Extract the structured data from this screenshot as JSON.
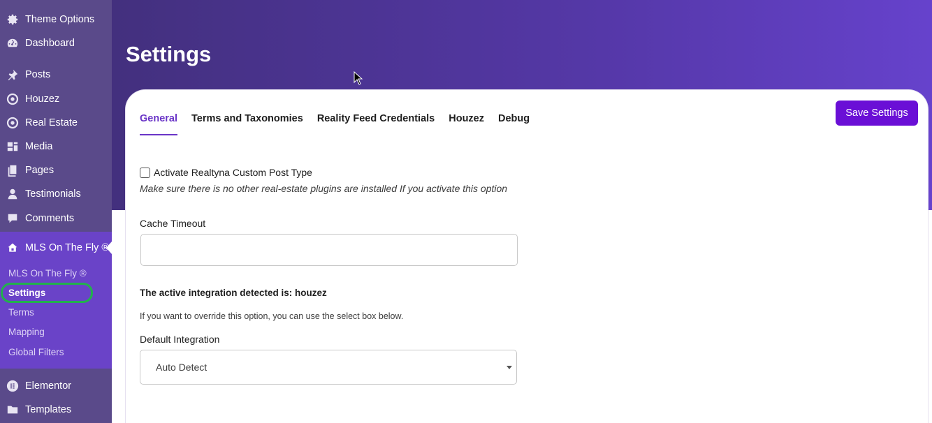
{
  "sidebar": {
    "items": [
      {
        "label": "Theme Options",
        "icon": "gear-icon"
      },
      {
        "label": "Dashboard",
        "icon": "dashboard-icon"
      },
      {
        "label": "Posts",
        "icon": "pin-icon"
      },
      {
        "label": "Houzez",
        "icon": "location-icon"
      },
      {
        "label": "Real Estate",
        "icon": "location-icon"
      },
      {
        "label": "Media",
        "icon": "media-icon"
      },
      {
        "label": "Pages",
        "icon": "pages-icon"
      },
      {
        "label": "Testimonials",
        "icon": "user-icon"
      },
      {
        "label": "Comments",
        "icon": "comment-icon"
      }
    ],
    "active_menu": {
      "label": "MLS On The Fly ®",
      "icon": "house-icon"
    },
    "submenu": [
      {
        "label": "MLS On The Fly ®"
      },
      {
        "label": "Settings",
        "current": true
      },
      {
        "label": "Terms"
      },
      {
        "label": "Mapping"
      },
      {
        "label": "Global Filters"
      }
    ],
    "bottom_items": [
      {
        "label": "Elementor",
        "icon": "elementor-icon"
      },
      {
        "label": "Templates",
        "icon": "folder-icon"
      }
    ]
  },
  "page": {
    "title": "Settings"
  },
  "tabs": [
    "General",
    "Terms and Taxonomies",
    "Reality Feed Credentials",
    "Houzez",
    "Debug"
  ],
  "active_tab": "General",
  "save_button": "Save Settings",
  "form": {
    "checkbox_label": "Activate Realtyna Custom Post Type",
    "checkbox_checked": false,
    "checkbox_hint": "Make sure there is no other real-estate plugins are installed If you activate this option",
    "cache_label": "Cache Timeout",
    "cache_value": "",
    "integration_detected": "The active integration detected is: houzez",
    "override_note": "If you want to override this option, you can use the select box below.",
    "default_integration_label": "Default Integration",
    "default_integration_value": "Auto Detect"
  },
  "colors": {
    "sidebar_bg": "#5a4a8a",
    "active_menu_bg": "#6a43c8",
    "header_gradient_start": "#43307e",
    "header_gradient_end": "#6642cc",
    "accent": "#6a35c7",
    "save_button_bg": "#6a0fd6",
    "highlight_circle": "#22b14c"
  }
}
